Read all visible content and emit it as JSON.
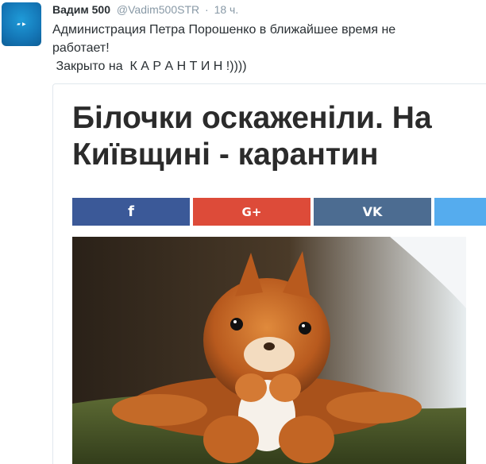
{
  "author": {
    "name": "Вадим 500",
    "handle": "@Vadim500STR",
    "separator": "·",
    "time": "18 ч."
  },
  "tweet": {
    "lines": [
      "Администрация Петра Порошенко в ближайшее время не",
      "работает!",
      " Закрыто на  К А Р А Н Т И Н !))))"
    ]
  },
  "card": {
    "headline_lines": [
      "Білочки оскаженіли. На",
      "Київщині - карантин"
    ],
    "share": {
      "facebook_icon": "f",
      "googleplus_icon": "G+",
      "vk_icon": "VK"
    },
    "image_subject": "squirrel"
  },
  "colors": {
    "facebook": "#3b5998",
    "googleplus": "#dd4b39",
    "vk": "#4c6c91",
    "twitter": "#55acee",
    "handle_gray": "#8899a6",
    "headline": "#2b2b2b"
  }
}
